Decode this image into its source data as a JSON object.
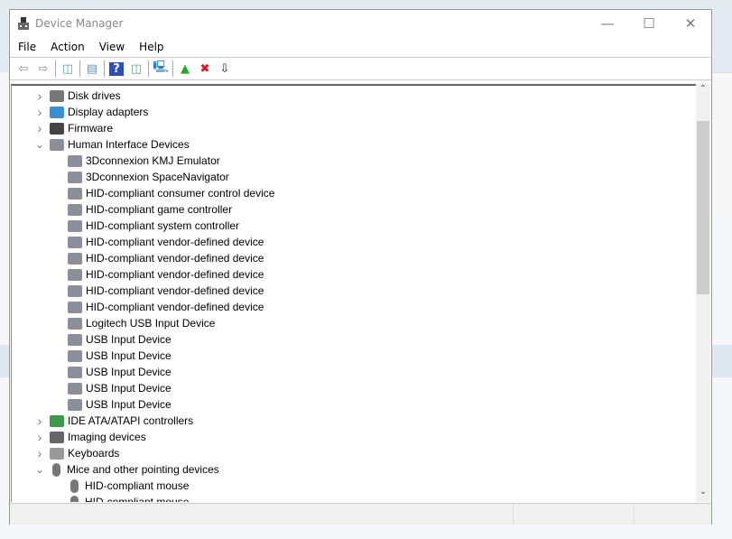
{
  "window": {
    "title": "Device Manager",
    "controls": [
      "minimize",
      "maximize",
      "close"
    ]
  },
  "menu": [
    "File",
    "Action",
    "View",
    "Help"
  ],
  "toolbar": [
    {
      "icon": "back-icon"
    },
    {
      "icon": "forward-icon"
    },
    {
      "sep": true
    },
    {
      "icon": "show-hide-console-tree-icon"
    },
    {
      "sep": true
    },
    {
      "icon": "properties-icon"
    },
    {
      "sep": true
    },
    {
      "icon": "help-icon"
    },
    {
      "icon": "action-pane-icon"
    },
    {
      "sep": true
    },
    {
      "icon": "scan-hardware-icon"
    },
    {
      "sep": true
    },
    {
      "icon": "update-driver-icon"
    },
    {
      "icon": "uninstall-icon",
      "color": "#e81123"
    },
    {
      "icon": "download-icon"
    }
  ],
  "tree": [
    {
      "label": "Disk drives",
      "level": 0,
      "state": "collapsed",
      "icon": "disk-icon"
    },
    {
      "label": "Display adapters",
      "level": 0,
      "state": "collapsed",
      "icon": "monitor-icon"
    },
    {
      "label": "Firmware",
      "level": 0,
      "state": "collapsed",
      "icon": "chip-icon"
    },
    {
      "label": "Human Interface Devices",
      "level": 0,
      "state": "expanded",
      "icon": "hid-icon"
    },
    {
      "label": "3Dconnexion KMJ Emulator",
      "level": 1,
      "icon": "hid-icon"
    },
    {
      "label": "3Dconnexion SpaceNavigator",
      "level": 1,
      "icon": "hid-icon"
    },
    {
      "label": "HID-compliant consumer control device",
      "level": 1,
      "icon": "hid-icon"
    },
    {
      "label": "HID-compliant game controller",
      "level": 1,
      "icon": "hid-icon"
    },
    {
      "label": "HID-compliant system controller",
      "level": 1,
      "icon": "hid-icon"
    },
    {
      "label": "HID-compliant vendor-defined device",
      "level": 1,
      "icon": "hid-icon"
    },
    {
      "label": "HID-compliant vendor-defined device",
      "level": 1,
      "icon": "hid-icon"
    },
    {
      "label": "HID-compliant vendor-defined device",
      "level": 1,
      "icon": "hid-icon"
    },
    {
      "label": "HID-compliant vendor-defined device",
      "level": 1,
      "icon": "hid-icon"
    },
    {
      "label": "HID-compliant vendor-defined device",
      "level": 1,
      "icon": "hid-icon"
    },
    {
      "label": "Logitech USB Input Device",
      "level": 1,
      "icon": "hid-icon"
    },
    {
      "label": "USB Input Device",
      "level": 1,
      "icon": "hid-icon"
    },
    {
      "label": "USB Input Device",
      "level": 1,
      "icon": "hid-icon"
    },
    {
      "label": "USB Input Device",
      "level": 1,
      "icon": "hid-icon"
    },
    {
      "label": "USB Input Device",
      "level": 1,
      "icon": "hid-icon"
    },
    {
      "label": "USB Input Device",
      "level": 1,
      "icon": "hid-icon"
    },
    {
      "label": "IDE ATA/ATAPI controllers",
      "level": 0,
      "state": "collapsed",
      "icon": "ide-controller-icon"
    },
    {
      "label": "Imaging devices",
      "level": 0,
      "state": "collapsed",
      "icon": "camera-icon"
    },
    {
      "label": "Keyboards",
      "level": 0,
      "state": "collapsed",
      "icon": "keyboard-icon"
    },
    {
      "label": "Mice and other pointing devices",
      "level": 0,
      "state": "expanded",
      "icon": "mouse-icon"
    },
    {
      "label": "HID-compliant mouse",
      "level": 1,
      "icon": "mouse-icon"
    },
    {
      "label": "HID-compliant mouse",
      "level": 1,
      "icon": "mouse-icon"
    }
  ]
}
